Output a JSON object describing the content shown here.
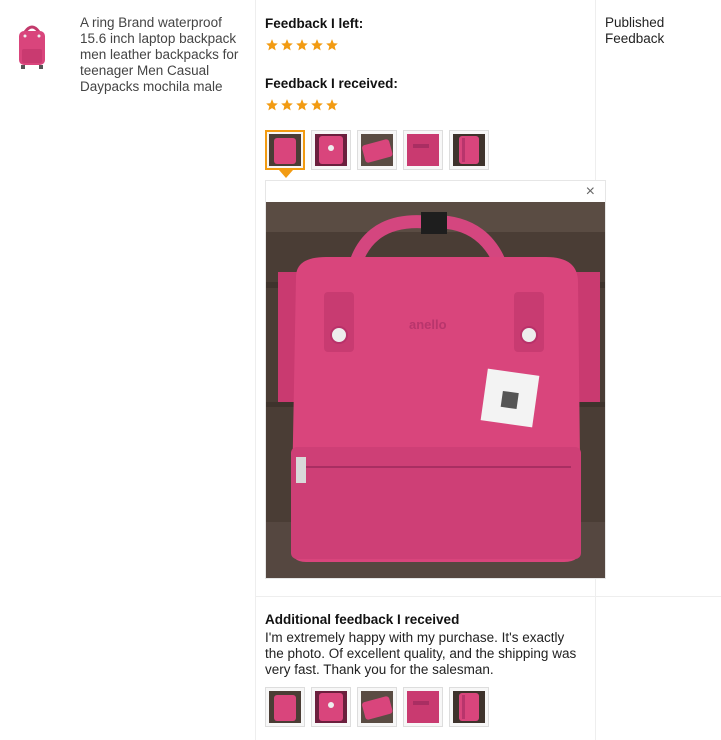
{
  "product": {
    "title": "A ring Brand waterproof 15.6 inch laptop backpack men leather backpacks for teenager Men Casual Daypacks mochila male",
    "thumb_icon": "backpack-thumbnail"
  },
  "feedback": {
    "left_label": "Feedback I left:",
    "left_stars": 5,
    "received_label": "Feedback I received:",
    "received_stars": 5,
    "star_color": "#f29b12"
  },
  "photos": {
    "count": 5,
    "selected_index": 0,
    "close_symbol": "×",
    "brand_text_on_bag": "anello"
  },
  "status": {
    "published_label": "Published Feedback"
  },
  "additional": {
    "title": "Additional feedback I received",
    "text": "I'm extremely happy with my purchase. It's exactly the photo. Of excellent quality, and the shipping was very fast. Thank you for the salesman.",
    "photo_count": 5
  }
}
